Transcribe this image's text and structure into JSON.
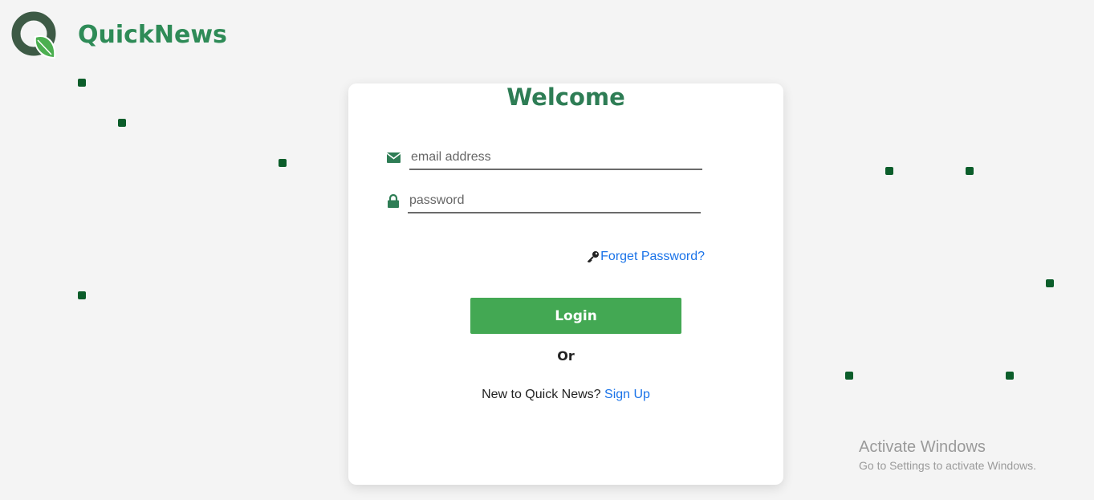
{
  "brand": {
    "name": "QuickNews",
    "logo_icon": "q-leaf-logo-icon",
    "color": "#2e8b57"
  },
  "login": {
    "title": "Welcome",
    "email": {
      "placeholder": "email address",
      "value": "",
      "icon": "envelope-icon"
    },
    "password": {
      "placeholder": "password",
      "value": "",
      "icon": "lock-icon"
    },
    "forgot_label": "Forget Password?",
    "forgot_icon": "key-icon",
    "login_label": "Login",
    "or_label": "Or",
    "signup_prompt": "New to Quick News?",
    "signup_link": "Sign Up"
  },
  "watermark": {
    "title": "Activate Windows",
    "subtitle": "Go to Settings to activate Windows."
  },
  "colors": {
    "accent": "#2e7d55",
    "button": "#43a853",
    "link": "#1a73e8",
    "dot": "#0b5d2a",
    "background": "#f4f4f4"
  }
}
